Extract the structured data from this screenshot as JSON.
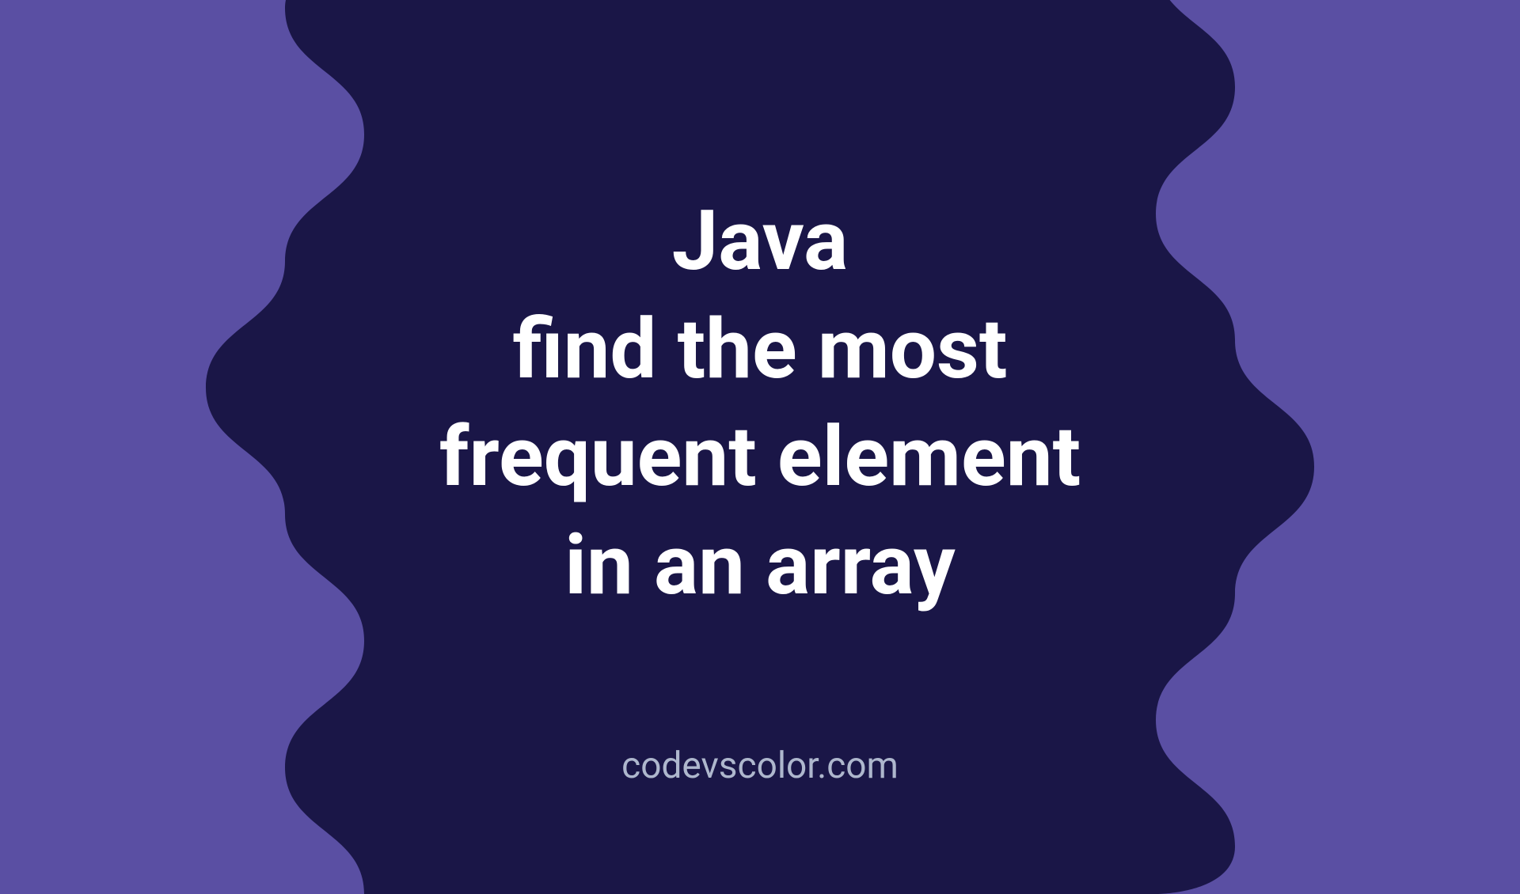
{
  "title": {
    "line1": "Java",
    "line2": "find the most",
    "line3": "frequent element",
    "line4": "in an array"
  },
  "website": "codevscolor.com",
  "colors": {
    "background": "#5a4fa3",
    "blob": "#1a1647",
    "text": "#ffffff",
    "website_text": "#aeb7cd"
  }
}
